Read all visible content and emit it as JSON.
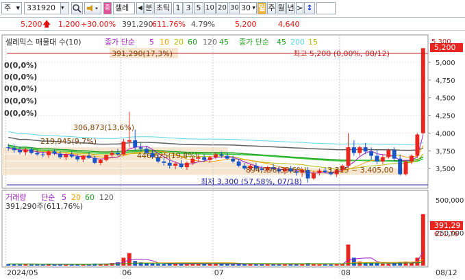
{
  "toolbar": {
    "market_label": "주",
    "stock_code": "331920",
    "stock_name": "셀레",
    "period_prev": "◀",
    "period_label": "분",
    "tick_label": "초틱",
    "intervals": [
      "1",
      "3",
      "5",
      "10",
      "20",
      "30"
    ],
    "interval_value": "30",
    "day_label": "일",
    "week_label": "주",
    "month_label": "월",
    "year_label": "년",
    "next_label": ">",
    "updown_label": "↕"
  },
  "price_bar": {
    "price": "5,200",
    "change": "1,200",
    "change_rate": "+30.00%",
    "volume": "391,290",
    "volume_rate": "611.76%",
    "turnover_rate": "4.79%",
    "high": "5,200",
    "low": "4,640"
  },
  "price_panel": {
    "title": "셀레믹스 매물대 수(10)",
    "ma_label": "종가 단순",
    "ma_periods": [
      "5",
      "10",
      "20",
      "60",
      "120"
    ],
    "ma2_label": "종가 단순",
    "ma2_periods": [
      "45",
      "200",
      "15"
    ],
    "volume_profile_top": "391,290(17,3%)",
    "high_note": "최고 5,200 (0,00%, 08/12)",
    "low_note": "최저 3,300 (57,58%, 07/18)",
    "zero_labels": [
      "0(0,0%)",
      "0(0,0%)",
      "0(0,0%)",
      "0(0,0%)",
      "0(0,0%)"
    ],
    "profile_labels": [
      "306,873(13,6%)",
      "219,945(9,7%)",
      "446,625(19,8%)",
      "894,998(39,6%)",
      "3,315 ~ 3,405,00"
    ],
    "current_price_tag": "5,200",
    "prev_tag": "5,300"
  },
  "volume_panel": {
    "title": "거래량",
    "ma_label": "단순",
    "ma_periods": [
      "5",
      "20",
      "60",
      "120"
    ],
    "volume_text": "391,290주(611,76%)",
    "current_tag": "391,29",
    "rate_tag": "611,76"
  },
  "x_axis": [
    "2024/05",
    "06",
    "07",
    "08",
    "08/12"
  ],
  "colors": {
    "up": "#e8261f",
    "down": "#1a55c8",
    "ma5": "#a020c0",
    "ma10": "#f0a000",
    "ma20": "#b8b800",
    "ma60": "#20a020",
    "ma120": "#606060",
    "ma200": "#58d8e8",
    "profile": "#f6e6cf"
  },
  "chart_data": {
    "type": "candlestick",
    "y_ticks": [
      3500,
      3750,
      4000,
      4250,
      4500,
      4750,
      5000
    ],
    "ylim": [
      3250,
      5300
    ],
    "volume_ticks": [
      "500,000",
      "250,000"
    ],
    "candles": [
      [
        3800,
        3850,
        3750,
        3790
      ],
      [
        3790,
        3840,
        3720,
        3760
      ],
      [
        3760,
        3810,
        3700,
        3730
      ],
      [
        3730,
        3790,
        3690,
        3770
      ],
      [
        3770,
        3800,
        3700,
        3720
      ],
      [
        3720,
        3760,
        3680,
        3700
      ],
      [
        3700,
        3740,
        3660,
        3690
      ],
      [
        3690,
        3760,
        3650,
        3740
      ],
      [
        3740,
        3770,
        3690,
        3710
      ],
      [
        3710,
        3740,
        3640,
        3660
      ],
      [
        3660,
        3720,
        3620,
        3700
      ],
      [
        3700,
        3740,
        3650,
        3670
      ],
      [
        3670,
        3700,
        3600,
        3630
      ],
      [
        3630,
        3690,
        3590,
        3680
      ],
      [
        3680,
        3730,
        3640,
        3650
      ],
      [
        3650,
        3680,
        3560,
        3580
      ],
      [
        3580,
        3640,
        3550,
        3620
      ],
      [
        3620,
        3700,
        3600,
        3690
      ],
      [
        3690,
        3760,
        3660,
        3720
      ],
      [
        3720,
        3780,
        3680,
        3700
      ],
      [
        3700,
        3920,
        3680,
        3880
      ],
      [
        3880,
        4300,
        3800,
        3900
      ],
      [
        3900,
        4050,
        3750,
        3800
      ],
      [
        3800,
        3860,
        3740,
        3780
      ],
      [
        3780,
        3820,
        3700,
        3720
      ],
      [
        3720,
        3760,
        3640,
        3660
      ],
      [
        3660,
        3700,
        3580,
        3600
      ],
      [
        3600,
        3650,
        3540,
        3580
      ],
      [
        3580,
        3620,
        3500,
        3540
      ],
      [
        3540,
        3600,
        3490,
        3570
      ],
      [
        3570,
        3620,
        3500,
        3520
      ],
      [
        3520,
        3600,
        3480,
        3580
      ],
      [
        3580,
        3660,
        3550,
        3640
      ],
      [
        3640,
        3700,
        3600,
        3660
      ],
      [
        3660,
        3700,
        3600,
        3620
      ],
      [
        3620,
        3680,
        3580,
        3660
      ],
      [
        3660,
        3720,
        3630,
        3700
      ],
      [
        3700,
        3740,
        3650,
        3680
      ],
      [
        3680,
        3720,
        3620,
        3640
      ],
      [
        3640,
        3680,
        3580,
        3600
      ],
      [
        3600,
        3640,
        3520,
        3540
      ],
      [
        3540,
        3580,
        3480,
        3500
      ],
      [
        3500,
        3560,
        3460,
        3540
      ],
      [
        3540,
        3580,
        3480,
        3500
      ],
      [
        3500,
        3540,
        3450,
        3480
      ],
      [
        3480,
        3540,
        3440,
        3520
      ],
      [
        3520,
        3560,
        3470,
        3490
      ],
      [
        3490,
        3530,
        3440,
        3460
      ],
      [
        3460,
        3520,
        3420,
        3500
      ],
      [
        3500,
        3540,
        3440,
        3460
      ],
      [
        3460,
        3500,
        3400,
        3440
      ],
      [
        3440,
        3500,
        3380,
        3480
      ],
      [
        3480,
        3520,
        3300,
        3360
      ],
      [
        3360,
        3460,
        3340,
        3440
      ],
      [
        3440,
        3500,
        3400,
        3470
      ],
      [
        3470,
        3520,
        3430,
        3450
      ],
      [
        3450,
        3500,
        3400,
        3420
      ],
      [
        3420,
        3500,
        3380,
        3480
      ],
      [
        3480,
        3560,
        3450,
        3540
      ],
      [
        3540,
        4000,
        3500,
        3800
      ],
      [
        3800,
        3900,
        3680,
        3720
      ],
      [
        3720,
        3820,
        3680,
        3800
      ],
      [
        3800,
        3860,
        3700,
        3740
      ],
      [
        3740,
        3800,
        3620,
        3680
      ],
      [
        3680,
        3760,
        3560,
        3600
      ],
      [
        3600,
        3700,
        3560,
        3660
      ],
      [
        3660,
        3780,
        3640,
        3760
      ],
      [
        3760,
        3800,
        3600,
        3640
      ],
      [
        3640,
        3700,
        3400,
        3420
      ],
      [
        3420,
        3620,
        3400,
        3600
      ],
      [
        3600,
        3700,
        3560,
        3680
      ],
      [
        3680,
        4000,
        3650,
        3980
      ],
      [
        4000,
        5200,
        3980,
        5200
      ]
    ],
    "volumes": [
      12,
      14,
      10,
      11,
      9,
      8,
      10,
      12,
      9,
      8,
      10,
      9,
      8,
      11,
      10,
      15,
      12,
      14,
      20,
      25,
      60,
      95,
      35,
      25,
      18,
      15,
      13,
      12,
      14,
      12,
      11,
      13,
      15,
      14,
      12,
      13,
      14,
      12,
      11,
      10,
      12,
      13,
      11,
      10,
      12,
      11,
      10,
      11,
      13,
      12,
      11,
      12,
      20,
      14,
      12,
      11,
      10,
      12,
      14,
      160,
      60,
      30,
      25,
      20,
      18,
      15,
      14,
      16,
      28,
      30,
      22,
      60,
      391
    ]
  }
}
